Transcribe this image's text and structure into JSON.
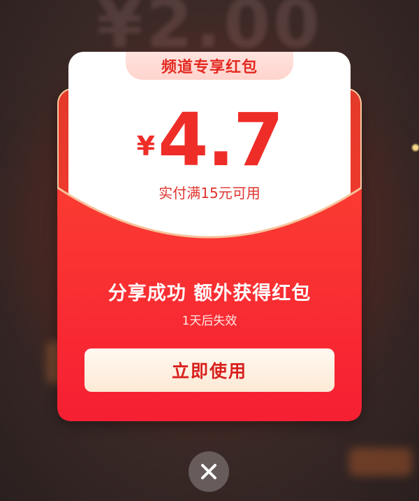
{
  "background": {
    "amount_text": "¥2.00"
  },
  "coupon": {
    "tab_label": "频道专享红包",
    "currency_symbol": "¥",
    "amount": "4.7",
    "condition": "实付满15元可用",
    "message": "分享成功 额外获得红包",
    "expiry": "1天后失效",
    "use_button_label": "立即使用"
  },
  "controls": {
    "close_icon": "close-icon"
  },
  "colors": {
    "accent_red": "#ef2d28",
    "envelope_red": "#f5323a",
    "button_bg": "#fdf0e2",
    "tab_bg": "#ffd9d3"
  }
}
